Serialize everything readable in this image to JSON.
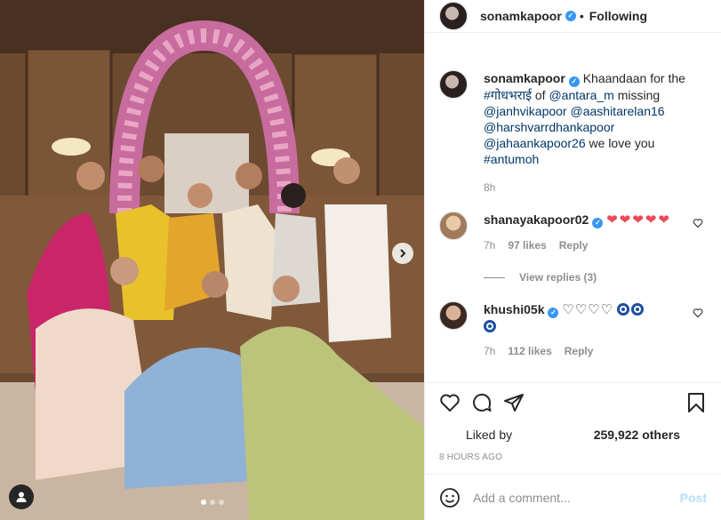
{
  "post": {
    "author": "sonamkapoor",
    "verified": true,
    "follow_status": "Following",
    "caption": {
      "text_before": "Khaandaan for the",
      "hashtag1": "#गोधभराई",
      "of_word": "of",
      "mention1": "@antara_m",
      "missing_word": "missing",
      "mention2": "@janhvikapoor",
      "mention3": "@aashitarelan16",
      "mention4": "@harshvarrdhankapoor",
      "mention5": "@jahaankapoor26",
      "text_after": "we love you",
      "hashtag2": "#antumoh"
    },
    "caption_time": "8h"
  },
  "comments": [
    {
      "user": "shanayakapoor02",
      "verified": true,
      "text": "❤❤❤❤❤",
      "time": "7h",
      "likes": "97 likes",
      "reply_label": "Reply",
      "view_replies": "View replies (3)"
    },
    {
      "user": "khushi05k",
      "verified": true,
      "text": "♡♡♡♡",
      "time": "7h",
      "likes": "112 likes",
      "reply_label": "Reply"
    }
  ],
  "stats": {
    "liked_by": "Liked by",
    "count": "259,922 others",
    "posted": "8 HOURS AGO"
  },
  "composer": {
    "placeholder": "Add a comment...",
    "post_label": "Post"
  },
  "icons": [
    "like-icon",
    "comment-icon",
    "share-icon",
    "bookmark-icon",
    "next-arrow-icon",
    "user-tag-icon",
    "emoji-icon",
    "verified-badge-icon",
    "more-options-icon"
  ],
  "colors": {
    "link": "#00376b",
    "verified": "#3897f0",
    "heart": "#ed4956",
    "post_disabled": "#b2dffc"
  },
  "carousel": {
    "slides": 3,
    "active": 1
  }
}
